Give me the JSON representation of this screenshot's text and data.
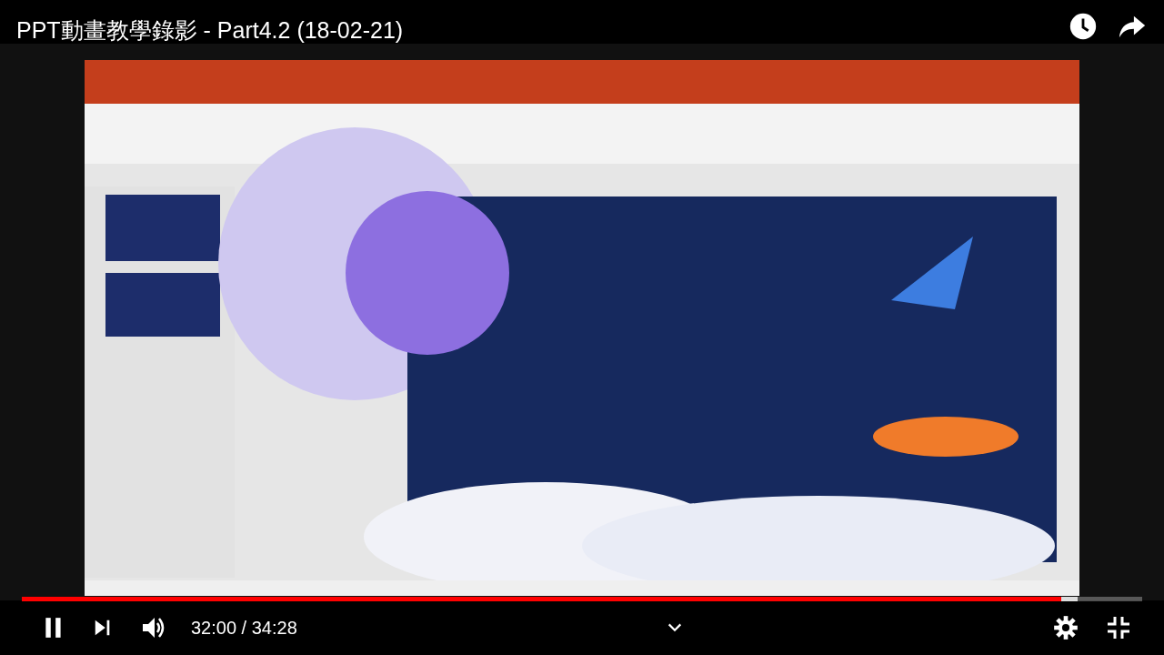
{
  "video": {
    "kind": "picture",
    "title": "PPT動畫教學錄影 - Part4.2 (18-02-21)"
  },
  "player": {
    "playing": true,
    "progress": {
      "level": 0.928
    },
    "buffered": {
      "level": 0.942
    },
    "time": "32:00 / 34:28"
  }
}
